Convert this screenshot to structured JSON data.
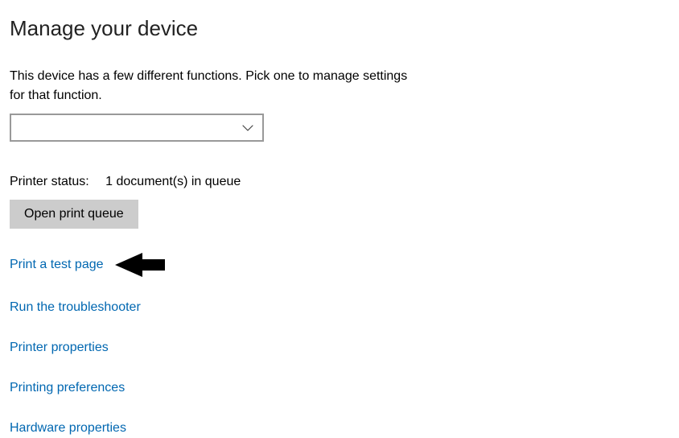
{
  "heading": "Manage your device",
  "subtitle": "This device has a few different functions. Pick one to manage settings for that function.",
  "dropdown": {
    "selected": ""
  },
  "status": {
    "label": "Printer status:",
    "value": "1 document(s) in queue"
  },
  "buttons": {
    "open_print_queue": "Open print queue"
  },
  "links": {
    "print_test_page": "Print a test page",
    "run_troubleshooter": "Run the troubleshooter",
    "printer_properties": "Printer properties",
    "printing_preferences": "Printing preferences",
    "hardware_properties": "Hardware properties"
  },
  "colors": {
    "link": "#0067b1",
    "button_bg": "#cccccc",
    "border": "#999999"
  }
}
